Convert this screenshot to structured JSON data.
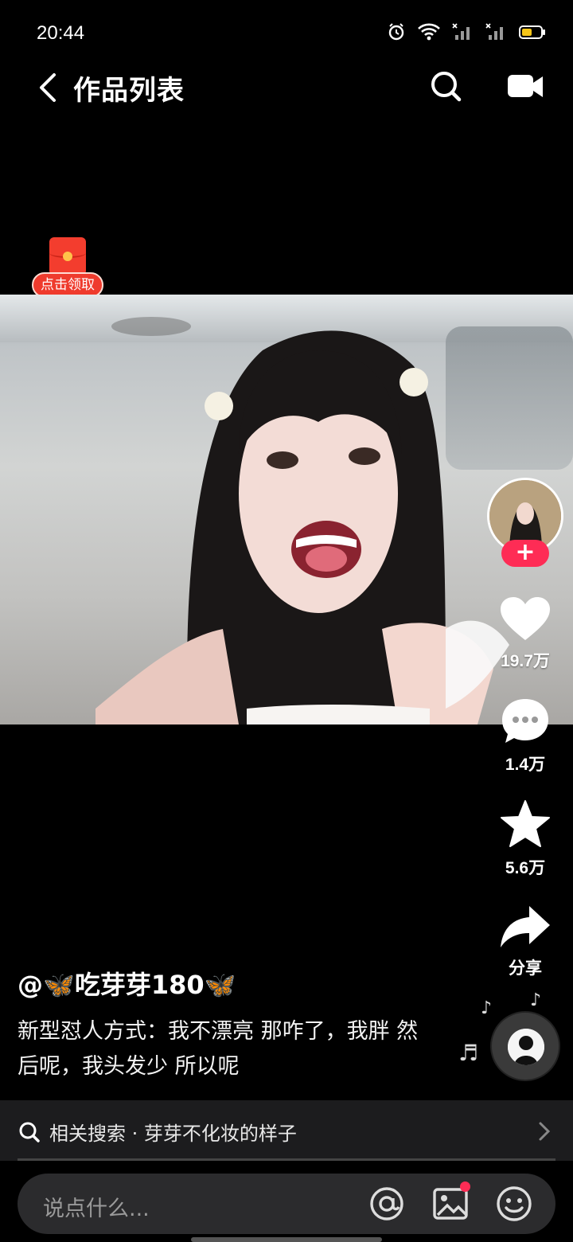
{
  "status_bar": {
    "time": "20:44"
  },
  "header": {
    "title": "作品列表"
  },
  "red_packet": {
    "label": "点击领取"
  },
  "actions": {
    "likes": "19.7万",
    "comments": "1.4万",
    "favorites": "5.6万",
    "share": "分享"
  },
  "post": {
    "author": "@🦋吃芽芽180🦋",
    "description": "新型怼人方式：我不漂亮 那咋了，我胖 然后呢，我头发少 所以呢"
  },
  "related_search": {
    "label": "相关搜索 · 芽芽不化妆的样子"
  },
  "comment_input": {
    "placeholder": "说点什么..."
  },
  "colors": {
    "accent": "#fe2c55",
    "background": "#000000"
  },
  "icons": [
    "back-arrow-icon",
    "search-icon",
    "video-camera-icon",
    "heart-icon",
    "comment-icon",
    "star-icon",
    "share-icon",
    "music-disc-icon",
    "at-icon",
    "image-icon",
    "emoji-icon"
  ]
}
